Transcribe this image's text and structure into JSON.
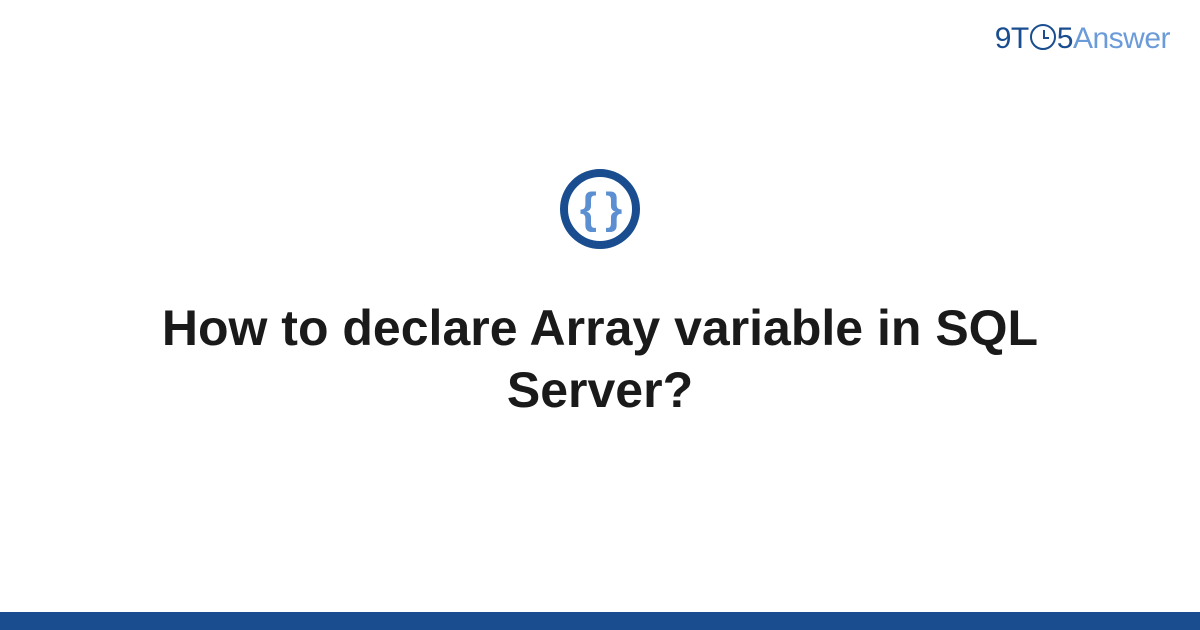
{
  "logo": {
    "part1": "9T",
    "part2": "5",
    "part3": "Answer"
  },
  "category_icon": {
    "symbol": "{ }",
    "name": "code-braces"
  },
  "title": "How to declare Array variable in SQL Server?",
  "colors": {
    "primary": "#1a4d8f",
    "secondary": "#6b9bd8",
    "text": "#1a1a1a"
  }
}
